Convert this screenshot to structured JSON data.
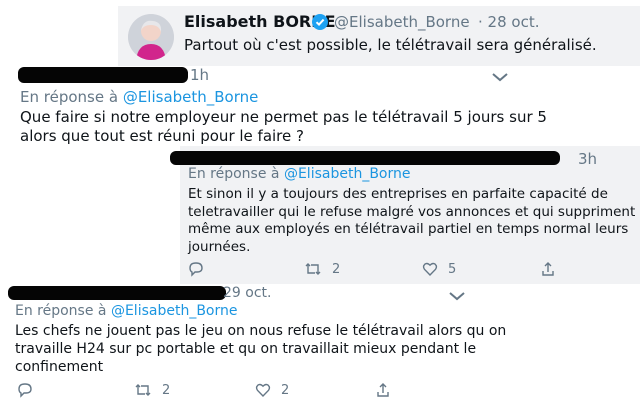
{
  "quoted_tweet": {
    "author_name": "Elisabeth BORNE",
    "verified": true,
    "handle": "@Elisabeth_Borne",
    "date": "· 28 oct.",
    "text": "Partout où c'est possible, le télétravail sera généralisé."
  },
  "reply1": {
    "time": "1h",
    "reply_prefix": "En réponse à",
    "reply_to": "@Elisabeth_Borne",
    "text": "Que faire si notre employeur ne permet pas le télétravail 5 jours sur 5\nalors que tout est réuni pour le faire ?"
  },
  "reply2": {
    "time": "3h",
    "reply_prefix": "En réponse à",
    "reply_to": "@Elisabeth_Borne",
    "text": "Et sinon il y a toujours des entreprises en parfaite capacité de\nteletravailler qui le refuse malgré vos annonces et qui suppriment\nmême aux employés en télétravail partiel en temps normal leurs\njournées.",
    "retweet_count": "2",
    "like_count": "5"
  },
  "reply3": {
    "time": "29 oct.",
    "reply_prefix": "En réponse à",
    "reply_to": "@Elisabeth_Borne",
    "text": "Les chefs ne jouent pas le jeu on nous refuse le télétravail alors qu on\ntravaille H24 sur pc portable et qu on travaillait mieux pendant le\nconfinement",
    "retweet_count": "2",
    "like_count": "2"
  },
  "icons": [
    "reply-icon",
    "retweet-icon",
    "like-icon",
    "share-icon",
    "chevron-down-icon",
    "verified-badge-icon",
    "avatar"
  ],
  "colors": {
    "link_blue": "#1b95e0",
    "muted": "#657786",
    "verified": "#1da1f2",
    "panel_bg": "#f1f2f4"
  }
}
